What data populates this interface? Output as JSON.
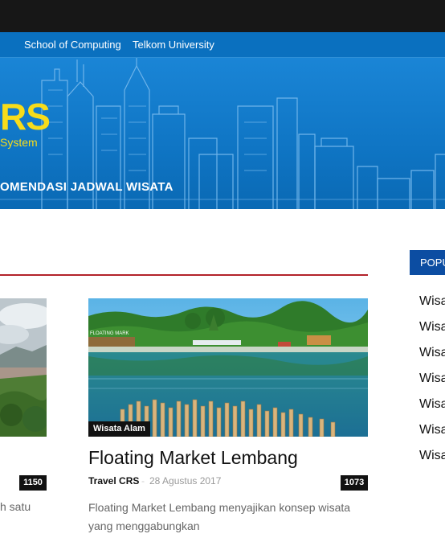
{
  "nav": {
    "links": [
      "School of Computing",
      "Telkom University"
    ]
  },
  "header": {
    "logo_text": "RS",
    "logo_subtitle": "System",
    "menu_title": "OMENDASI JADWAL WISATA"
  },
  "sidebar": {
    "popular_tab_label": "POPU",
    "popular_items": [
      "Wisa",
      "Wisa",
      "Wisa",
      "Wisa",
      "Wisa",
      "Wisa",
      "Wisa"
    ]
  },
  "left_post": {
    "count": "1150",
    "excerpt": "h satu"
  },
  "main_post": {
    "category": "Wisata Alam",
    "title": "Floating Market Lembang",
    "author": "Travel CRS",
    "separator": "-",
    "date": "28 Agustus 2017",
    "count": "1073",
    "excerpt": "Floating Market Lembang menyajikan konsep wisata yang menggabungkan",
    "sign_text": "FLOATING MARK"
  },
  "colors": {
    "nav_blue": "#0a70bf",
    "logo_yellow": "#f7dc1a",
    "divider_red": "#b3222b",
    "tab_blue": "#0c4da2"
  }
}
